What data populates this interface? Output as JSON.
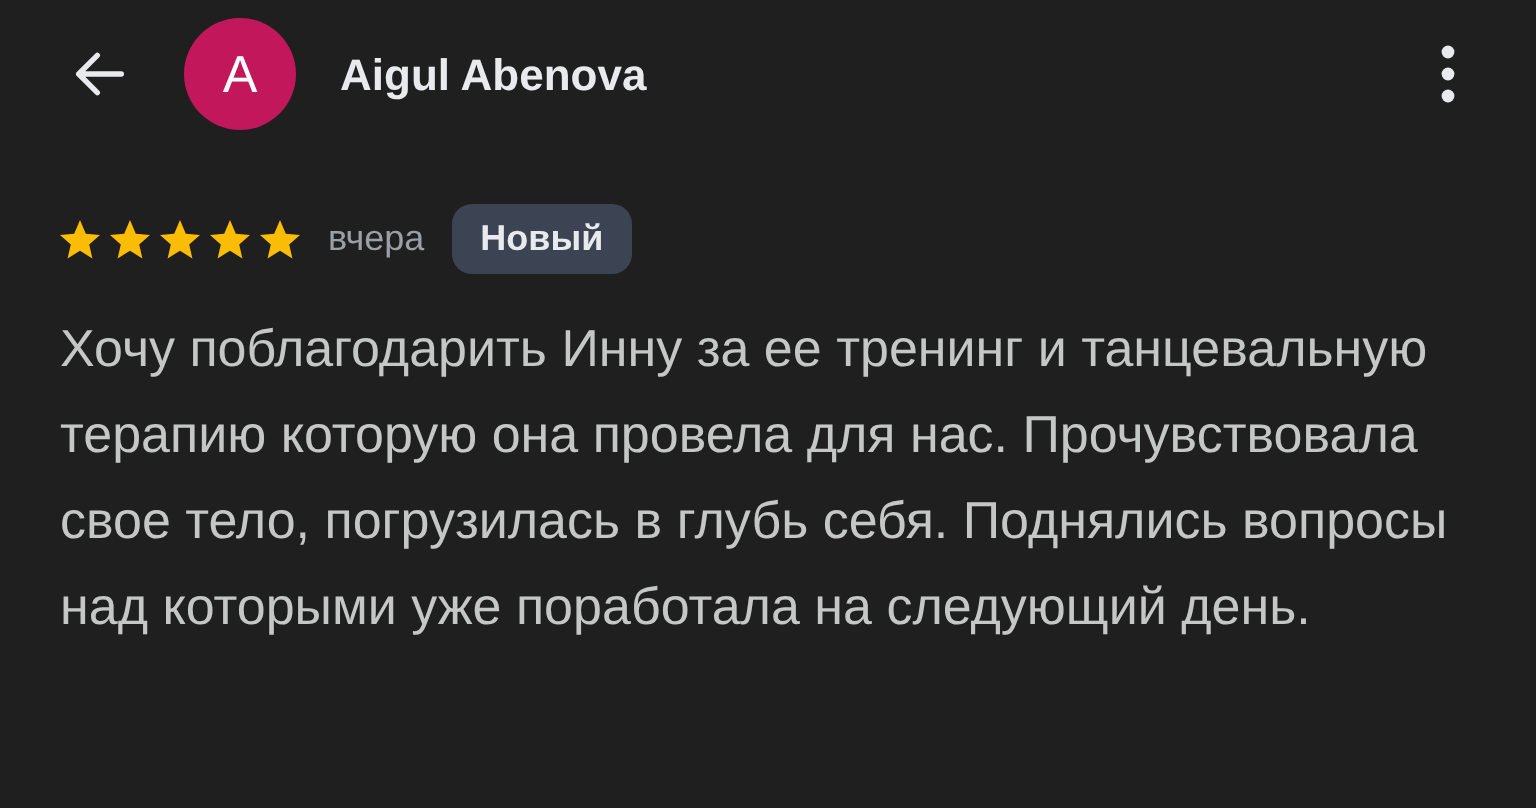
{
  "header": {
    "avatar_letter": "A",
    "name": "Aigul Abenova"
  },
  "review": {
    "stars": 5,
    "date": "вчера",
    "badge": "Новый",
    "text": "Хочу поблагодарить Инну за ее тренинг и танцевальную терапию которую она провела для нас. Прочувствовала свое тело, погрузилась в глубь себя. Поднялись вопросы над которыми уже поработала на следующий день."
  }
}
